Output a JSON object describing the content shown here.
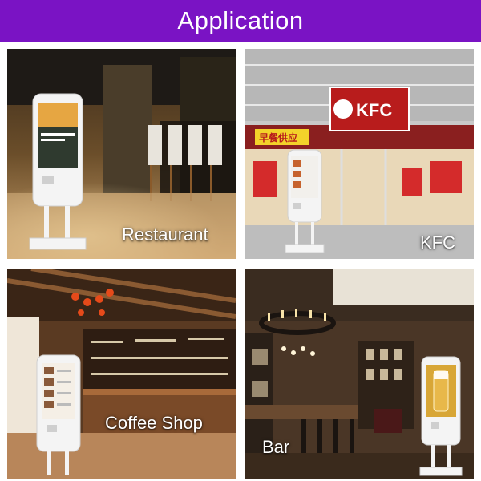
{
  "header": {
    "title": "Application",
    "background": "#7a13c4"
  },
  "tiles": [
    {
      "label": "Restaurant"
    },
    {
      "label": "KFC",
      "sign_text": "KFC",
      "sub_sign": "早餐供应"
    },
    {
      "label": "Coffee Shop"
    },
    {
      "label": "Bar"
    }
  ]
}
